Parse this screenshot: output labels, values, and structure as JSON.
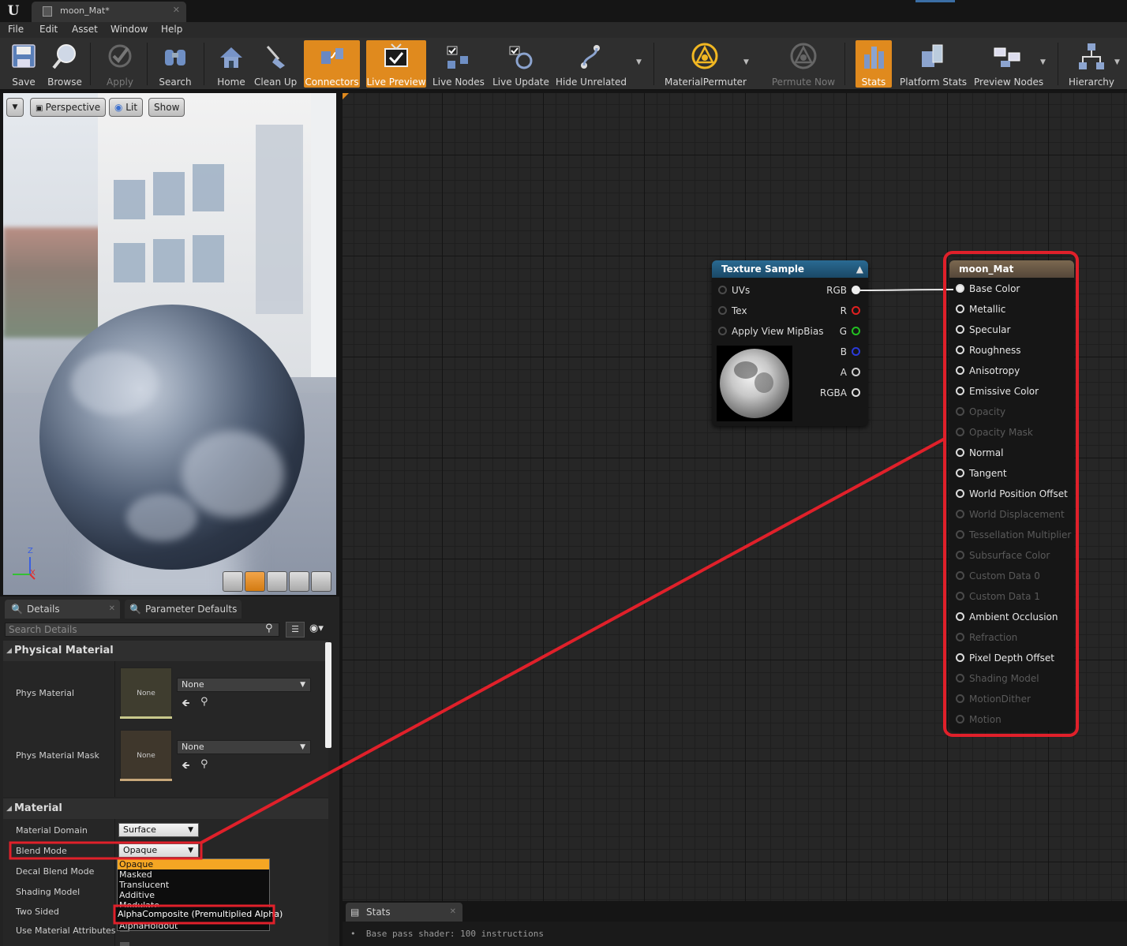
{
  "window": {
    "tab_title": "moon_Mat*"
  },
  "menu": [
    "File",
    "Edit",
    "Asset",
    "Window",
    "Help"
  ],
  "toolbar": {
    "buttons": [
      {
        "label": "Save",
        "icon": "save-icon"
      },
      {
        "label": "Browse",
        "icon": "browse-icon"
      },
      {
        "label": "Apply",
        "icon": "apply-icon",
        "disabled": true
      },
      {
        "label": "Search",
        "icon": "binoculars-icon"
      },
      {
        "label": "Home",
        "icon": "home-icon"
      },
      {
        "label": "Clean Up",
        "icon": "broom-icon"
      },
      {
        "label": "Connectors",
        "icon": "connectors-icon",
        "active": true
      },
      {
        "label": "Live Preview",
        "icon": "tv-icon",
        "active": true
      },
      {
        "label": "Live Nodes",
        "icon": "live-nodes-icon"
      },
      {
        "label": "Live Update",
        "icon": "live-update-icon"
      },
      {
        "label": "Hide Unrelated",
        "icon": "hide-unrelated-icon"
      },
      {
        "label": "MaterialPermuter",
        "icon": "permuter-icon"
      },
      {
        "label": "Permute Now",
        "icon": "permute-now-icon",
        "disabled": true
      },
      {
        "label": "Stats",
        "icon": "stats-icon",
        "active": true
      },
      {
        "label": "Platform Stats",
        "icon": "platform-stats-icon"
      },
      {
        "label": "Preview Nodes",
        "icon": "preview-nodes-icon"
      },
      {
        "label": "Hierarchy",
        "icon": "hierarchy-icon"
      }
    ]
  },
  "viewport": {
    "perspective_label": "Perspective",
    "lit_label": "Lit",
    "show_label": "Show",
    "axis_z": "Z",
    "axis_x": "X"
  },
  "details": {
    "tab_details": "Details",
    "tab_params": "Parameter Defaults",
    "search_placeholder": "Search Details",
    "physical_category": "Physical Material",
    "phys_material_label": "Phys Material",
    "phys_material_thumb": "None",
    "phys_material_value": "None",
    "phys_mask_label": "Phys Material Mask",
    "phys_mask_thumb": "None",
    "phys_mask_value": "None",
    "material_category": "Material",
    "material_domain_label": "Material Domain",
    "material_domain_value": "Surface",
    "blend_mode_label": "Blend Mode",
    "blend_mode_value": "Opaque",
    "decal_blend_label": "Decal Blend Mode",
    "shading_model_label": "Shading Model",
    "two_sided_label": "Two Sided",
    "use_attrs_label": "Use Material Attributes",
    "blend_options": [
      "Opaque",
      "Masked",
      "Translucent",
      "Additive",
      "Modulate"
    ],
    "blend_option_highlight": "AlphaComposite (Premultiplied Alpha)",
    "blend_option_partial": "AlphaHoldout"
  },
  "texture_node": {
    "title": "Texture Sample",
    "inputs": [
      "UVs",
      "Tex",
      "Apply View MipBias"
    ],
    "outputs": [
      {
        "label": "RGB",
        "color": "#eeeeee",
        "filled": true
      },
      {
        "label": "R",
        "color": "#e02020"
      },
      {
        "label": "G",
        "color": "#22c022"
      },
      {
        "label": "B",
        "color": "#2a3ad8"
      },
      {
        "label": "A",
        "color": "#cccccc"
      },
      {
        "label": "RGBA",
        "color": "#dddddd"
      }
    ]
  },
  "material_node": {
    "title": "moon_Mat",
    "pins": [
      {
        "label": "Base Color",
        "enabled": true,
        "filled": true
      },
      {
        "label": "Metallic",
        "enabled": true
      },
      {
        "label": "Specular",
        "enabled": true
      },
      {
        "label": "Roughness",
        "enabled": true
      },
      {
        "label": "Anisotropy",
        "enabled": true
      },
      {
        "label": "Emissive Color",
        "enabled": true
      },
      {
        "label": "Opacity",
        "enabled": false
      },
      {
        "label": "Opacity Mask",
        "enabled": false
      },
      {
        "label": "Normal",
        "enabled": true
      },
      {
        "label": "Tangent",
        "enabled": true
      },
      {
        "label": "World Position Offset",
        "enabled": true
      },
      {
        "label": "World Displacement",
        "enabled": false
      },
      {
        "label": "Tessellation Multiplier",
        "enabled": false
      },
      {
        "label": "Subsurface Color",
        "enabled": false
      },
      {
        "label": "Custom Data 0",
        "enabled": false
      },
      {
        "label": "Custom Data 1",
        "enabled": false
      },
      {
        "label": "Ambient Occlusion",
        "enabled": true
      },
      {
        "label": "Refraction",
        "enabled": false
      },
      {
        "label": "Pixel Depth Offset",
        "enabled": true
      },
      {
        "label": "Shading Model",
        "enabled": false
      },
      {
        "label": "MotionDither",
        "enabled": false
      },
      {
        "label": "Motion",
        "enabled": false
      }
    ]
  },
  "stats": {
    "tab_label": "Stats",
    "line": "Base pass shader: 100 instructions"
  },
  "colors": {
    "accent": "#e08a1e",
    "annotation": "#e0202a",
    "texture_header": "#1e4f6e",
    "material_header": "#6b5a45"
  }
}
